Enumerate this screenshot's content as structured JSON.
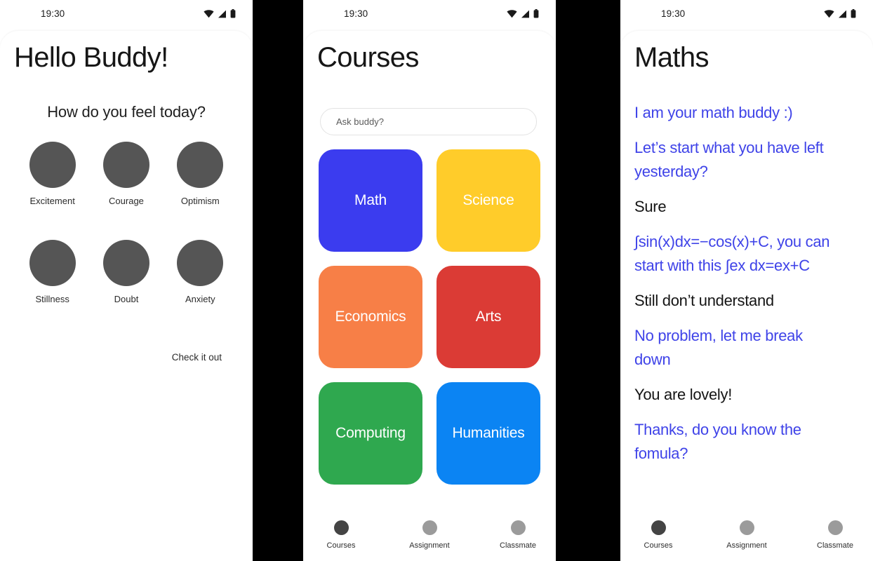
{
  "status_bar": {
    "time": "19:30",
    "icons": [
      "wifi-icon",
      "signal-icon",
      "battery-icon"
    ]
  },
  "screen_home": {
    "title": "Hello Buddy!",
    "question": "How do you feel today?",
    "moods": [
      {
        "label": "Excitement"
      },
      {
        "label": "Courage"
      },
      {
        "label": "Optimism"
      },
      {
        "label": "Stillness"
      },
      {
        "label": "Doubt"
      },
      {
        "label": "Anxiety"
      }
    ],
    "mood_dot_color": "#555555",
    "cta": "Check it out"
  },
  "screen_courses": {
    "title": "Courses",
    "search": {
      "placeholder": "Ask buddy?",
      "value": ""
    },
    "tiles": [
      {
        "label": "Math",
        "color": "#3B3CEF"
      },
      {
        "label": "Science",
        "color": "#FFCC2A"
      },
      {
        "label": "Economics",
        "color": "#F77F47"
      },
      {
        "label": "Arts",
        "color": "#DB3B35"
      },
      {
        "label": "Computing",
        "color": "#2FA84F"
      },
      {
        "label": "Humanities",
        "color": "#0B84F3"
      }
    ]
  },
  "screen_maths": {
    "title": "Maths",
    "messages": [
      {
        "sender": "bot",
        "text": "I am your math buddy :)"
      },
      {
        "sender": "bot",
        "text": "Let’s start what you have left yesterday?"
      },
      {
        "sender": "user",
        "text": "Sure"
      },
      {
        "sender": "bot",
        "text": "∫sin(x)dx=−cos(x)+C, you can start with this ∫ex dx=ex+C"
      },
      {
        "sender": "user",
        "text": "Still don’t understand"
      },
      {
        "sender": "bot",
        "text": "No problem, let me break down"
      },
      {
        "sender": "user",
        "text": "You are lovely!"
      },
      {
        "sender": "bot",
        "text": "Thanks, do you know the fomula?"
      }
    ],
    "bot_color": "#3f43e8",
    "user_color": "#151515"
  },
  "bottom_nav": {
    "items": [
      {
        "label": "Courses",
        "active": true
      },
      {
        "label": "Assignment",
        "active": false
      },
      {
        "label": "Classmate",
        "active": false
      }
    ],
    "active_dot_color": "#444444",
    "inactive_dot_color": "#9b9b9b"
  }
}
